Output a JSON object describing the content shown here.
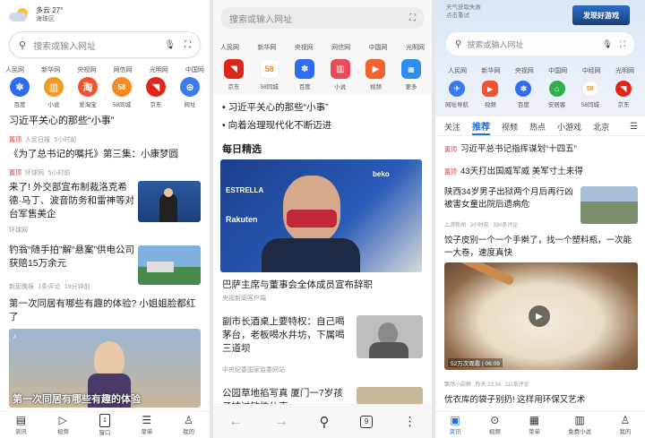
{
  "p1": {
    "weather": {
      "desc": "多云",
      "temp": "27°",
      "loc": "海珠区"
    },
    "search_placeholder": "搜索或输入网址",
    "links": [
      "人民网",
      "新华网",
      "央视网",
      "网信网",
      "光明网",
      "中国网"
    ],
    "apps": [
      {
        "label": "百度",
        "color": "#2e6bf3",
        "glyph": "✽"
      },
      {
        "label": "小说",
        "color": "#f29a1d",
        "glyph": "▥"
      },
      {
        "label": "爱淘宝",
        "color": "#f2522e",
        "glyph": "淘"
      },
      {
        "label": "58同城",
        "color": "#f58a1f",
        "glyph": "58"
      },
      {
        "label": "京东",
        "color": "#e1251b",
        "glyph": "◥"
      },
      {
        "label": "网址",
        "color": "#3a7bf0",
        "glyph": "⊕"
      }
    ],
    "headline": {
      "title": "习近平关心的那些“小事”",
      "tag": "置顶",
      "source": "人民日报",
      "time": "5小时前"
    },
    "news": [
      {
        "title": "《为了总书记的嘱托》第三集：小康梦圆",
        "tag": "置顶",
        "source": "环球网",
        "time": "5小时前"
      },
      {
        "title": "来了! 外交部宣布制裁洛克希德·马丁、波音防务和雷神等对台军售美企",
        "source": "环球网"
      },
      {
        "title": "钓翁“随手拍”解“悬案”供电公司获赔15万余元",
        "source": "新民晚报",
        "comments": "1条评论",
        "time": "19分钟前"
      },
      {
        "title": "第一次同居有哪些有趣的体验? 小姐姐脸都红了",
        "caption": "第一次同居有哪些有趣的体验"
      }
    ],
    "bottom": [
      "资讯",
      "视频",
      "窗口",
      "菜单",
      "我的"
    ],
    "window_count": "1"
  },
  "p2": {
    "search_placeholder": "搜索或输入网址",
    "links": [
      "人民网",
      "新华网",
      "央视网",
      "网信网",
      "中国网",
      "光明网"
    ],
    "apps": [
      {
        "label": "京东",
        "color": "#e1251b",
        "glyph": "◥"
      },
      {
        "label": "58同城",
        "color": "#f58a1f",
        "glyph": "58"
      },
      {
        "label": "百度",
        "color": "#2e6bf3",
        "glyph": "✽"
      },
      {
        "label": "小说",
        "color": "#e84b5a",
        "glyph": "▥"
      },
      {
        "label": "视频",
        "color": "#f2642e",
        "glyph": "▶"
      },
      {
        "label": "更多",
        "color": "#2e8ef0",
        "glyph": "⋮⋮"
      }
    ],
    "bullets": [
      "习近平关心的那些“小事”",
      "向着治理现代化不断迈进"
    ],
    "section": "每日精选",
    "feature": {
      "title": "巴萨主席与董事会全体成员宣布辞职",
      "source": "央视新闻客户端"
    },
    "news": [
      {
        "title": "副市长酒桌上要特权：自己喝茅台，老板喝水井坊，下属喝三道坝",
        "source": "中央纪委国家监委网站"
      },
      {
        "title": "公园草地掐写真 厦门一7岁孩子被过敏性休克"
      }
    ],
    "window_count": "9"
  },
  "p3": {
    "weather_line1": "天气获取失败",
    "weather_line2": "点击重试",
    "game_badge": "发现好游戏",
    "search_placeholder": "搜索或输入网址",
    "links": [
      "人民网",
      "新华网",
      "央视网",
      "中国网",
      "中经网",
      "光明网"
    ],
    "apps": [
      {
        "label": "网址导航",
        "color": "#3a7bf0",
        "glyph": "✈"
      },
      {
        "label": "视频",
        "color": "#f2522e",
        "glyph": "▶"
      },
      {
        "label": "百度",
        "color": "#2e6bf3",
        "glyph": "✽"
      },
      {
        "label": "安居客",
        "color": "#2fae4a",
        "glyph": "⌂"
      },
      {
        "label": "58同城",
        "color": "#f58a1f",
        "glyph": "58"
      },
      {
        "label": "京东",
        "color": "#e1251b",
        "glyph": "◥"
      }
    ],
    "tabs": [
      "关注",
      "推荐",
      "视频",
      "热点",
      "小游戏",
      "北京"
    ],
    "hot": [
      {
        "tag": "置顶",
        "title": "习近平总书记指挥谋划“十四五”"
      },
      {
        "tag": "置顶",
        "title": "43天打出国威军威 美军寸土未得"
      }
    ],
    "news": [
      {
        "title": "陕西34岁男子出狱两个月后再行凶被害女童出院后遗病危",
        "source": "上游新闻",
        "time": "3小时前",
        "comments": "390条评论"
      },
      {
        "title": "饺子皮别一个一个手擀了，找一个塑料瓶，一次能一大卷，速度真快",
        "views": "52万次观看",
        "duration": "06:09",
        "source": "飘然小厨娘",
        "time": "昨天 23:34",
        "comments": "111条评论"
      },
      {
        "title": "优衣库的袋子别扔! 这样用环保又艺术"
      }
    ],
    "bottom": [
      "资讯",
      "视频",
      "菜单",
      "免费小说",
      "我的"
    ]
  }
}
